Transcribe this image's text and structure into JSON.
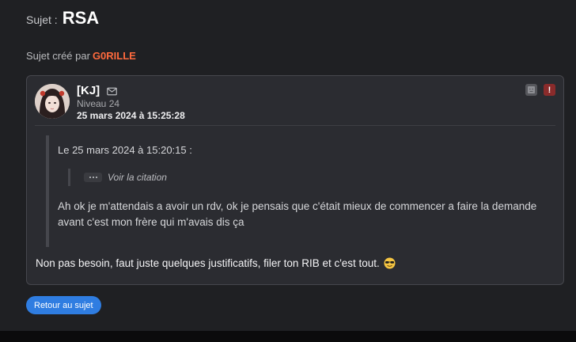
{
  "subject": {
    "prefix": "Sujet :",
    "title": "RSA"
  },
  "created_by": {
    "label": "Sujet créé par",
    "author": "G0RILLE"
  },
  "post": {
    "author": "[KJ]",
    "level": "Niveau 24",
    "date": "25 mars 2024 à 15:25:28",
    "quote": {
      "header": "Le 25 mars 2024 à 15:20:15 :",
      "nested_label": "Voir la citation",
      "text": "Ah ok je m'attendais a avoir un rdv, ok je pensais que c'était mieux de commencer a faire la demande avant c'est mon frère qui m'avais dis ça"
    },
    "body": "Non pas besoin, faut juste quelques justificatifs, filer ton RIB et c'est tout.",
    "icons": {
      "mail": "envelope-icon",
      "profile": "user-profile-icon",
      "report": "report-alert-icon",
      "emoji": "sunglasses-emoji-icon"
    }
  },
  "back_button": {
    "label": "Retour au sujet"
  },
  "colors": {
    "background": "#1f2023",
    "card": "#2b2c31",
    "accent_author": "#ff6a3d",
    "button": "#2f7de1",
    "report": "#8a2b2b"
  }
}
